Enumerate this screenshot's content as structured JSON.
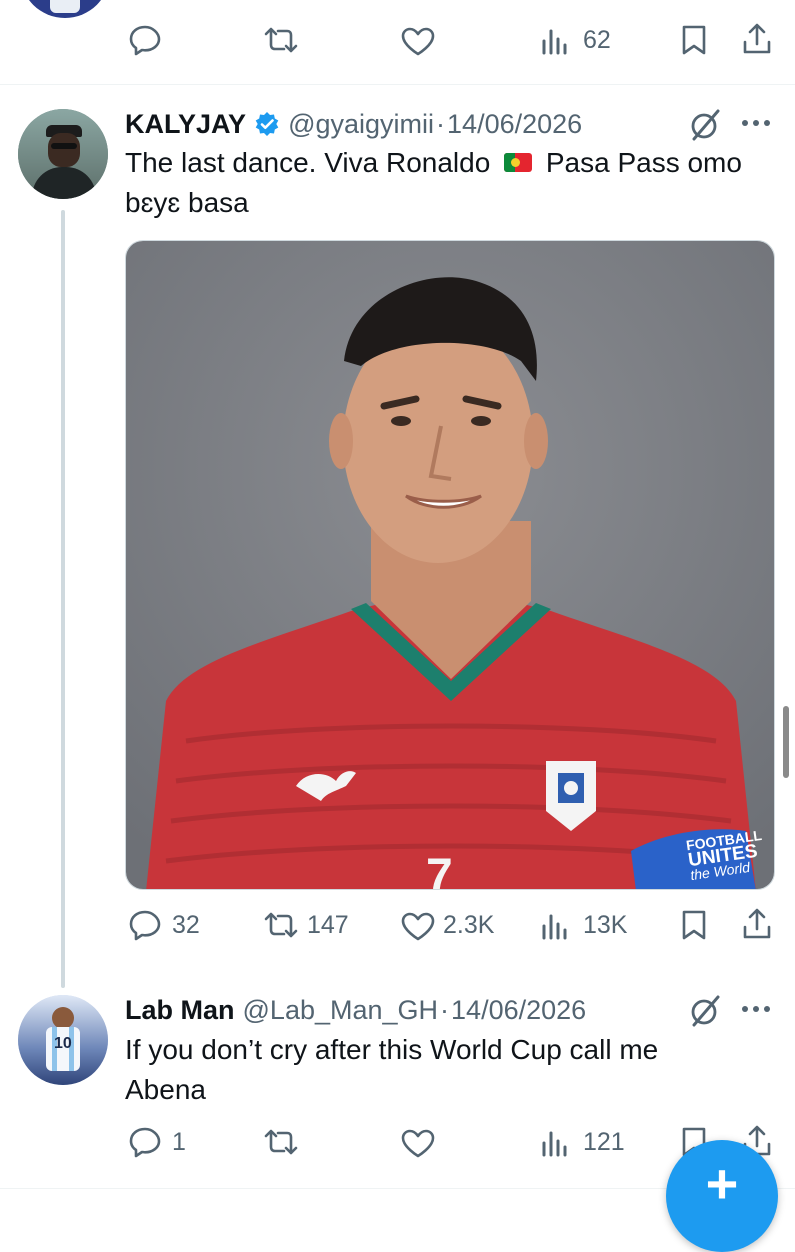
{
  "prev_tweet": {
    "views": "62",
    "icons": [
      "reply-icon",
      "retweet-icon",
      "like-icon",
      "views-icon",
      "bookmark-icon",
      "share-icon"
    ]
  },
  "main_tweet": {
    "name": "KALYJAY",
    "handle": "@gyaigyimii",
    "separator": "·",
    "date": "14/06/2026",
    "text_line1": "The last dance. Viva Ronaldo",
    "flag": "🇵🇹",
    "text_line1b": "Pasa Pass omo",
    "text_line2": "bɛyɛ basa",
    "media_alt": "Portrait of a footballer in a red Portugal jersey",
    "armband_text": [
      "FOOTBALL",
      "UNITES",
      "the World"
    ],
    "jersey_number": "7",
    "stats": {
      "replies": "32",
      "retweets": "147",
      "likes": "2.3K",
      "views": "13K"
    },
    "verified_color": "#1d9bf0"
  },
  "reply_tweet": {
    "name": "Lab Man",
    "handle": "@Lab_Man_GH",
    "separator": "·",
    "date": "14/06/2026",
    "text_line1": "If you don’t cry after this World Cup call me",
    "text_line2": "Abena",
    "avatar_jersey_number": "10",
    "stats": {
      "replies": "1",
      "views": "121"
    }
  },
  "fab": {
    "label": "+"
  },
  "colors": {
    "accent": "#1d9bf0",
    "muted": "#536471",
    "text": "#0f1419"
  }
}
